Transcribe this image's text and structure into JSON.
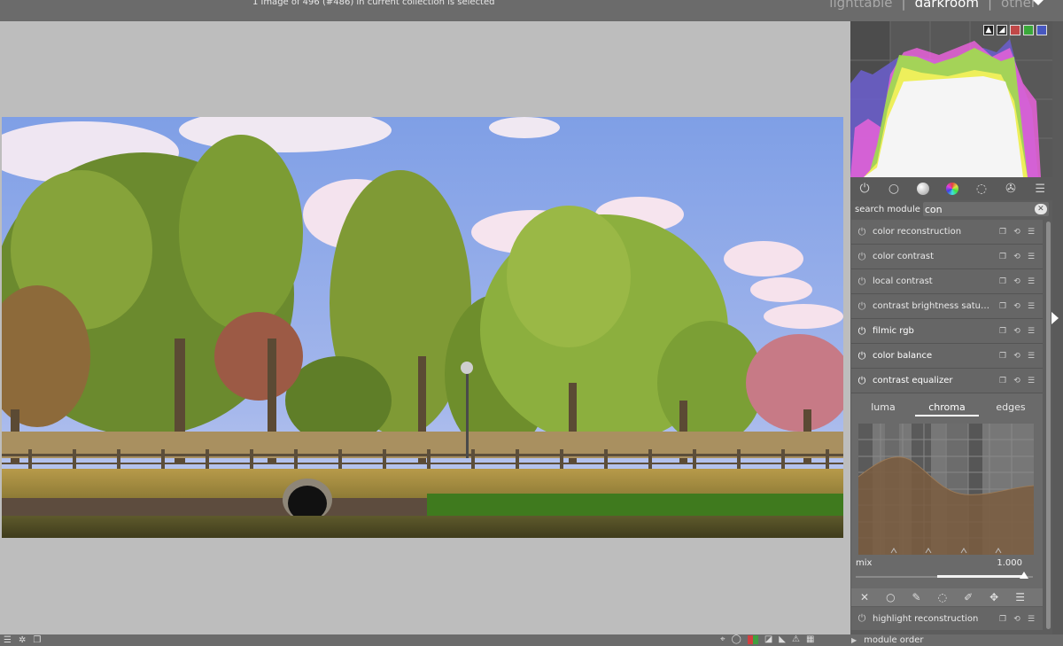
{
  "header": {
    "selection_info": "1 image of 496 (#486) in current collection is selected",
    "views": [
      "lighttable",
      "darkroom",
      "other"
    ],
    "view_separator": "|",
    "active_view": "darkroom"
  },
  "histogram": {
    "mode_buttons": [
      "exposure-icon",
      "waveform-icon"
    ],
    "channel_colors": [
      "#c04848",
      "#3aa83a",
      "#4858c0"
    ]
  },
  "module_groups": {
    "icons": [
      "power-icon",
      "circle-icon",
      "tone-sphere-icon",
      "color-wheel-icon",
      "correct-icon",
      "effect-icon",
      "menu-icon"
    ]
  },
  "search": {
    "label": "search module",
    "value": "con",
    "clear_icon": "clear-icon"
  },
  "modules": [
    {
      "label": "color reconstruction",
      "enabled": false
    },
    {
      "label": "color contrast",
      "enabled": false
    },
    {
      "label": "local contrast",
      "enabled": false
    },
    {
      "label": "contrast brightness saturation",
      "enabled": false
    },
    {
      "label": "filmic rgb",
      "enabled": true
    },
    {
      "label": "color balance",
      "enabled": true
    },
    {
      "label": "contrast equalizer",
      "enabled": true,
      "expanded": true
    }
  ],
  "contrast_equalizer": {
    "tabs": [
      "luma",
      "chroma",
      "edges"
    ],
    "active_tab": "chroma",
    "mix_label": "mix",
    "mix_value": "1.000",
    "mix_fraction": 1.0
  },
  "mask_bar": {
    "icons": [
      "mask-off-icon",
      "uniform-mask-icon",
      "drawn-mask-icon",
      "parametric-mask-icon",
      "drawn-parametric-mask-icon",
      "raster-mask-icon",
      "blend-menu-icon"
    ]
  },
  "highlight_module": {
    "label": "highlight reconstruction",
    "enabled": false
  },
  "module_order": {
    "label": "module order"
  },
  "colors": {
    "panel_bg": "#5d5d5d",
    "module_bg": "#666666",
    "center_bg": "#bdbdbd",
    "text": "#e9e9e9"
  }
}
